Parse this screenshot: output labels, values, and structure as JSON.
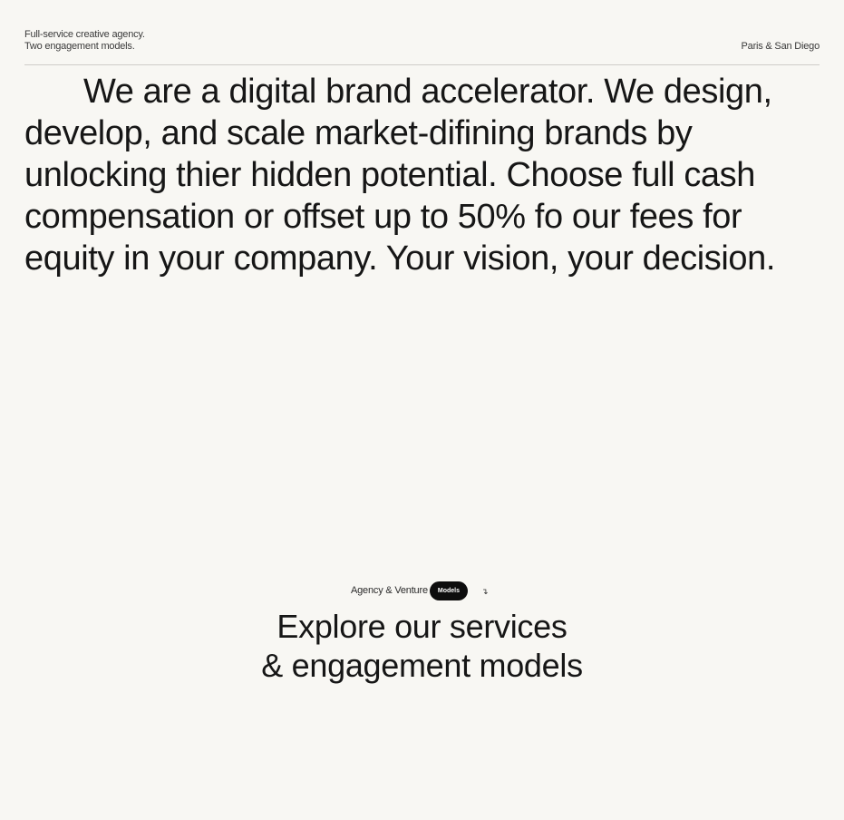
{
  "header": {
    "tagline_line1": "Full-service creative agency.",
    "tagline_line2": "Two engagement models.",
    "location": "Paris & San Diego"
  },
  "hero": {
    "text": "We are a digital brand accelerator. We design, develop, and scale market-difining brands by unlocking thier hidden potential. Choose full cash compensation or offset up to 50% fo our fees for equity in your company. Your vision, your decision."
  },
  "services": {
    "eyebrow": "Agency & Venture",
    "pill_label": "Models",
    "arrow_icon": "arrow-down-right-icon",
    "arrow_glyph": "↴",
    "heading_line1": "Explore our services",
    "heading_line2": "& engagement models"
  },
  "colors": {
    "background": "#f8f7f3",
    "text": "#161616",
    "pill": "#0d0d0d",
    "divider": "#cfcdc8"
  }
}
